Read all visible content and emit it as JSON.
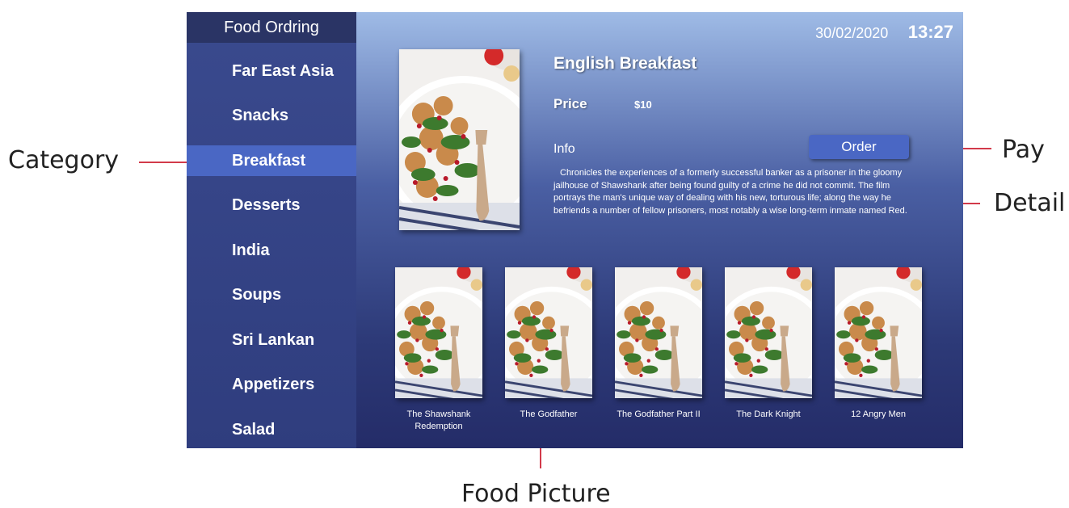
{
  "annotations": {
    "category": "Category",
    "pay": "Pay",
    "detail": "Detail",
    "food_picture": "Food Picture"
  },
  "sidebar": {
    "title": "Food Ordring",
    "items": [
      {
        "label": "Far East Asia"
      },
      {
        "label": "Snacks"
      },
      {
        "label": "Breakfast",
        "active": true
      },
      {
        "label": "Desserts"
      },
      {
        "label": "India"
      },
      {
        "label": "Soups"
      },
      {
        "label": "Sri Lankan"
      },
      {
        "label": "Appetizers"
      },
      {
        "label": "Salad"
      }
    ]
  },
  "header": {
    "date": "30/02/2020",
    "time": "13:27"
  },
  "detail": {
    "title": "English Breakfast",
    "price_label": "Price",
    "price_value": "$10",
    "info_label": "Info",
    "order_label": "Order",
    "info_text": "Chronicles the experiences of a formerly successful banker as a prisoner in the gloomy jailhouse of Shawshank after being found guilty of a crime he did not commit. The film portrays the man's unique way of dealing with his new, torturous life; along the way he befriends a number of fellow prisoners, most notably a wise long-term inmate named Red."
  },
  "thumbnails": [
    {
      "caption": "The Shawshank Redemption"
    },
    {
      "caption": "The Godfather"
    },
    {
      "caption": "The Godfather Part II"
    },
    {
      "caption": "The Dark Knight"
    },
    {
      "caption": "12 Angry Men"
    }
  ],
  "colors": {
    "accent": "#4a67c4",
    "annotation_line": "#d23a4a"
  }
}
